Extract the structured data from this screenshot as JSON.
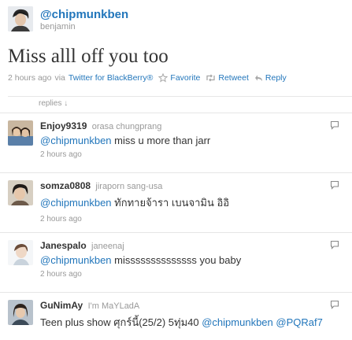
{
  "header": {
    "screen_name": "@chipmunkben",
    "real_name": "benjamin"
  },
  "tweet": {
    "text": "Miss alll off you too",
    "time": "2 hours ago",
    "via_prefix": "via",
    "via_app": "Twitter for BlackBerry®",
    "favorite_label": "Favorite",
    "retweet_label": "Retweet",
    "reply_label": "Reply"
  },
  "replies_label": "replies ↓",
  "replies": [
    {
      "user": "Enjoy9319",
      "name": "orasa chungprang",
      "mention": "@chipmunkben",
      "text": " miss u more than jarr",
      "time": "2 hours ago"
    },
    {
      "user": "somza0808",
      "name": "jiraporn sang-usa",
      "mention": "@chipmunkben",
      "text": " ทักทายจ้ารา เบนจามิน อิอิ",
      "time": "2 hours ago"
    },
    {
      "user": "Janespalo",
      "name": "janeenaj",
      "mention": "@chipmunkben",
      "text": " missssssssssssss you baby",
      "time": "2 hours ago"
    },
    {
      "user": "GuNimAy",
      "name": "I'm MaYLadA",
      "text_prefix": "Teen plus show ศุกร์นี้(25/2) 5ทุ่ม40 ",
      "mention": "@chipmunkben",
      "mention2": "@PQRaf7"
    }
  ],
  "colors": {
    "link": "#2276bb",
    "muted": "#999999",
    "text": "#333333"
  }
}
